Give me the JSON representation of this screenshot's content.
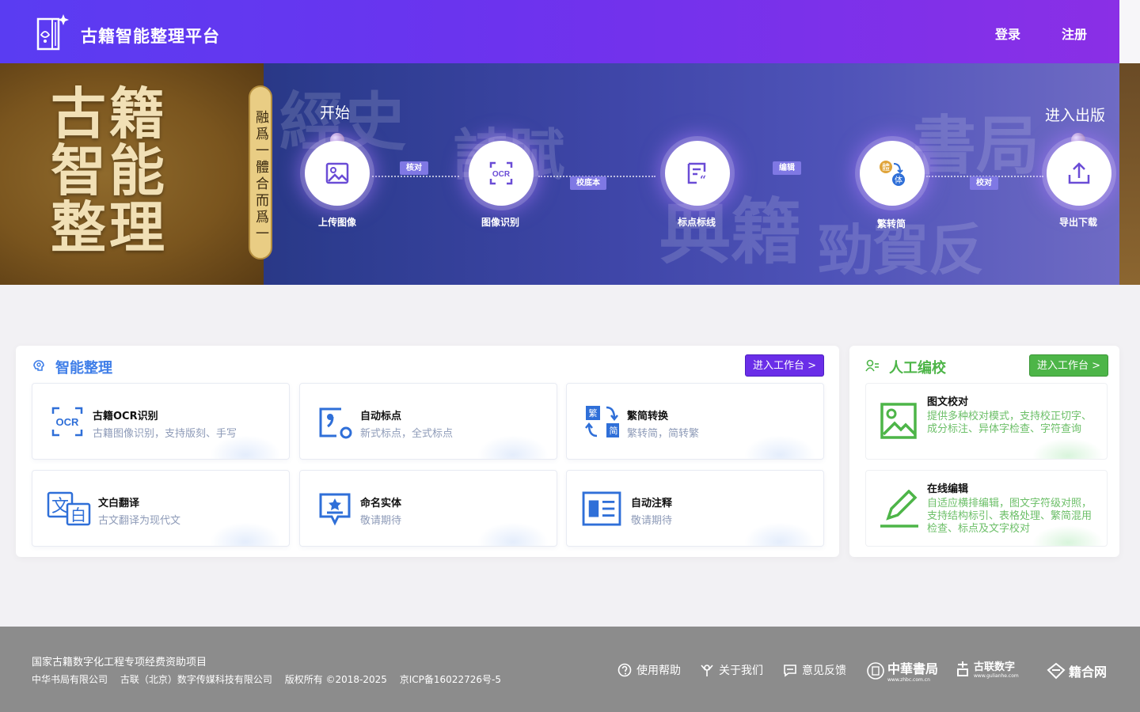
{
  "header": {
    "site_title": "古籍智能整理平台",
    "login": "登录",
    "register": "注册"
  },
  "banner": {
    "big_title": [
      "古籍",
      "智能",
      "整理"
    ],
    "scroll_text": "融爲一體合而爲一",
    "start_label": "开始",
    "end_label": "进入出版",
    "steps": [
      {
        "label": "上传图像",
        "icon": "image-icon"
      },
      {
        "label": "图像识别",
        "icon": "ocr-icon"
      },
      {
        "label": "标点标线",
        "icon": "punctuation-icon"
      },
      {
        "label": "繁转简",
        "icon": "convert-icon",
        "convert_from": "體",
        "convert_to": "体"
      },
      {
        "label": "导出下载",
        "icon": "export-icon"
      }
    ],
    "links": [
      "核对",
      "校底本",
      "编辑",
      "校对"
    ]
  },
  "smart": {
    "title": "智能整理",
    "enter": "进入工作台 >",
    "accent": "#3f7ee8",
    "button_color": "#6a2ee8",
    "cards": [
      {
        "title": "古籍OCR识别",
        "desc": "古籍图像识别，支持版刻、手写",
        "icon": "ocr-icon",
        "icon_text": "OCR"
      },
      {
        "title": "自动标点",
        "desc": "新式标点，全式标点",
        "icon": "punctuation-icon"
      },
      {
        "title": "繁简转换",
        "desc": "繁转简，简转繁",
        "icon": "convert-icon",
        "trad": "繁",
        "simp": "简"
      },
      {
        "title": "文白翻译",
        "desc": "古文翻译为现代文",
        "icon": "translate-icon",
        "glyph_a": "文",
        "glyph_b": "白"
      },
      {
        "title": "命名实体",
        "desc": "敬请期待",
        "icon": "entity-icon"
      },
      {
        "title": "自动注释",
        "desc": "敬请期待",
        "icon": "annotation-icon"
      }
    ]
  },
  "manual": {
    "title": "人工编校",
    "enter": "进入工作台 >",
    "accent": "#4db548",
    "cards": [
      {
        "title": "图文校对",
        "desc": "提供多种校对模式，支持校正切字、成分标注、异体字检查、字符查询",
        "icon": "image-proof-icon"
      },
      {
        "title": "在线编辑",
        "desc": "自适应横排编辑，图文字符级对照，支持结构标引、表格处理、繁简混用检查、标点及文字校对",
        "icon": "edit-pen-icon"
      }
    ]
  },
  "footer": {
    "line1": "国家古籍数字化工程专项经费资助项目",
    "company1": "中华书局有限公司",
    "company2": "古联（北京）数字传媒科技有限公司",
    "copyright": "版权所有 ©2018-2025",
    "icp": "京ICP备16022726号-5",
    "links": [
      "使用帮助",
      "关于我们",
      "意见反馈"
    ],
    "partners": [
      {
        "name": "中華書局",
        "url_text": "www.zhbc.com.cn"
      },
      {
        "name": "古联数字",
        "url_text": "www.gulianhe.com"
      },
      {
        "name": "籍合网",
        "url_text": ""
      }
    ]
  }
}
